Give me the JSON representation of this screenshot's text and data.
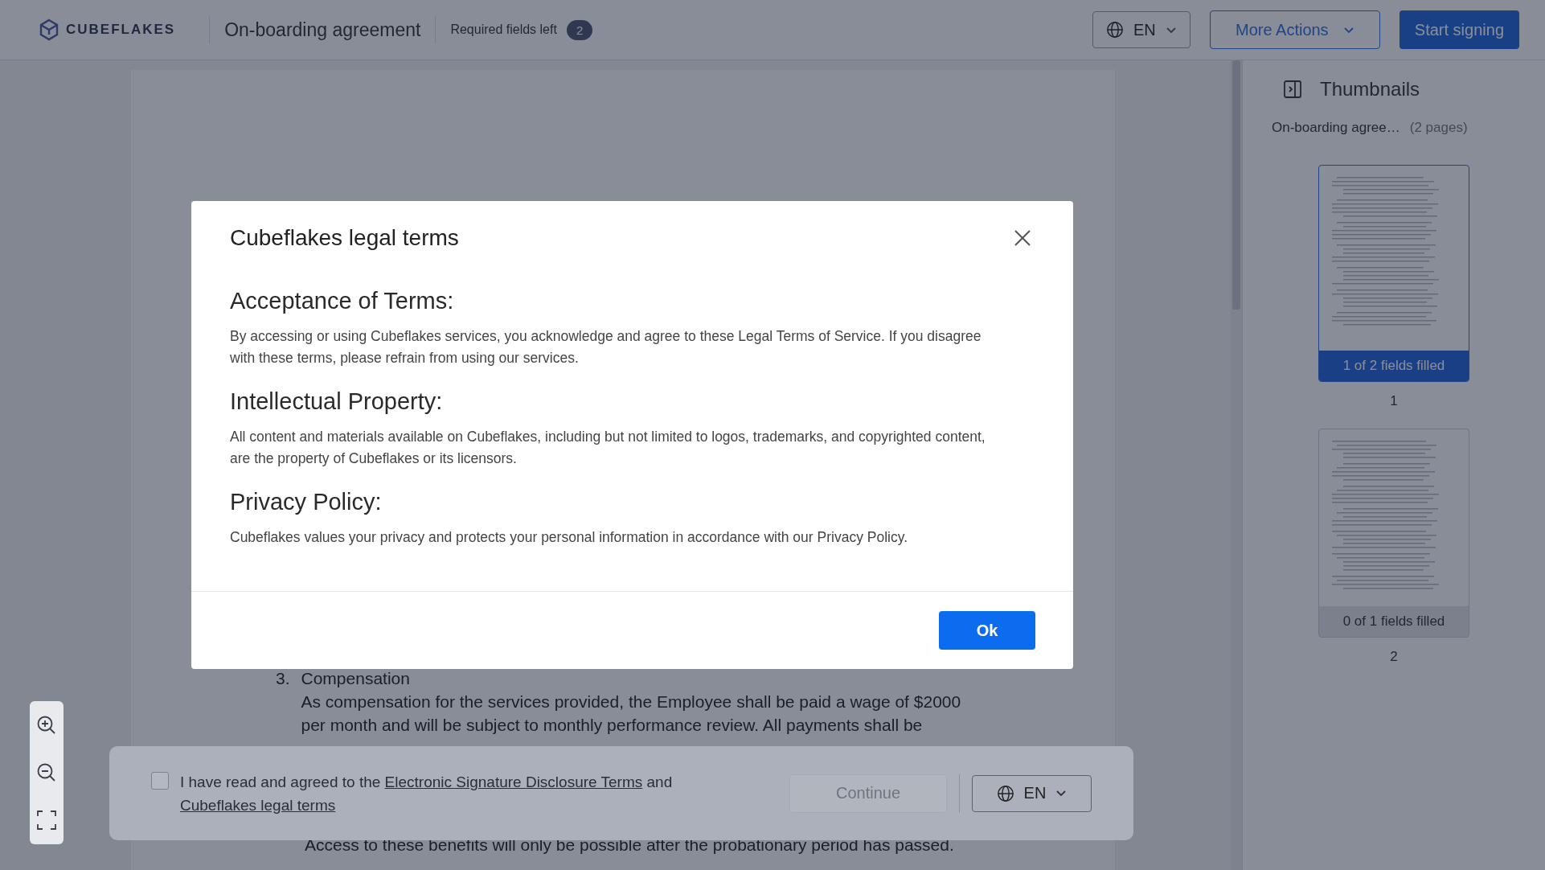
{
  "header": {
    "logo": "CUBEFLAKES",
    "document_title": "On-boarding agreement",
    "required_label": "Required fields left",
    "required_count": "2",
    "language": "EN",
    "more_actions": "More Actions",
    "start_signing": "Start signing"
  },
  "document": {
    "number": "3.",
    "heading": "Compensation",
    "paragraph": "As compensation for the services provided, the Employee shall be paid a wage of $2000 per month and will be subject to monthly performance review. All payments shall be",
    "trailing_line": "Access to these benefits will only be possible after the probationary period has passed."
  },
  "consent_bar": {
    "checked": false,
    "text_before": "I have read and agreed to the",
    "link_1": "Electronic Signature Disclosure Terms",
    "text_middle": "and",
    "link_2": "Cubeflakes legal terms",
    "continue_label": "Continue",
    "continue_disabled": true,
    "language": "EN"
  },
  "thumbnails": {
    "title": "Thumbnails",
    "document_name": "On-boarding agree…",
    "page_count": "(2 pages)",
    "pages": [
      {
        "status": "1 of 2 fields filled",
        "number": "1",
        "selected": true
      },
      {
        "status": "0 of 1 fields filled",
        "number": "2",
        "selected": false
      }
    ]
  },
  "modal": {
    "title": "Cubeflakes legal terms",
    "sections": [
      {
        "heading": "Acceptance of Terms:",
        "body": "By accessing or using Cubeflakes services, you acknowledge and agree to these Legal Terms of Service. If you disagree with these terms, please refrain from using our services."
      },
      {
        "heading": "Intellectual Property:",
        "body": "All content and materials available on Cubeflakes, including but not limited to logos, trademarks, and copyrighted content, are the property of Cubeflakes or its licensors."
      },
      {
        "heading": "Privacy Policy:",
        "body": "Cubeflakes values your privacy and protects your personal information in accordance with our Privacy Policy."
      }
    ],
    "ok": "Ok"
  }
}
